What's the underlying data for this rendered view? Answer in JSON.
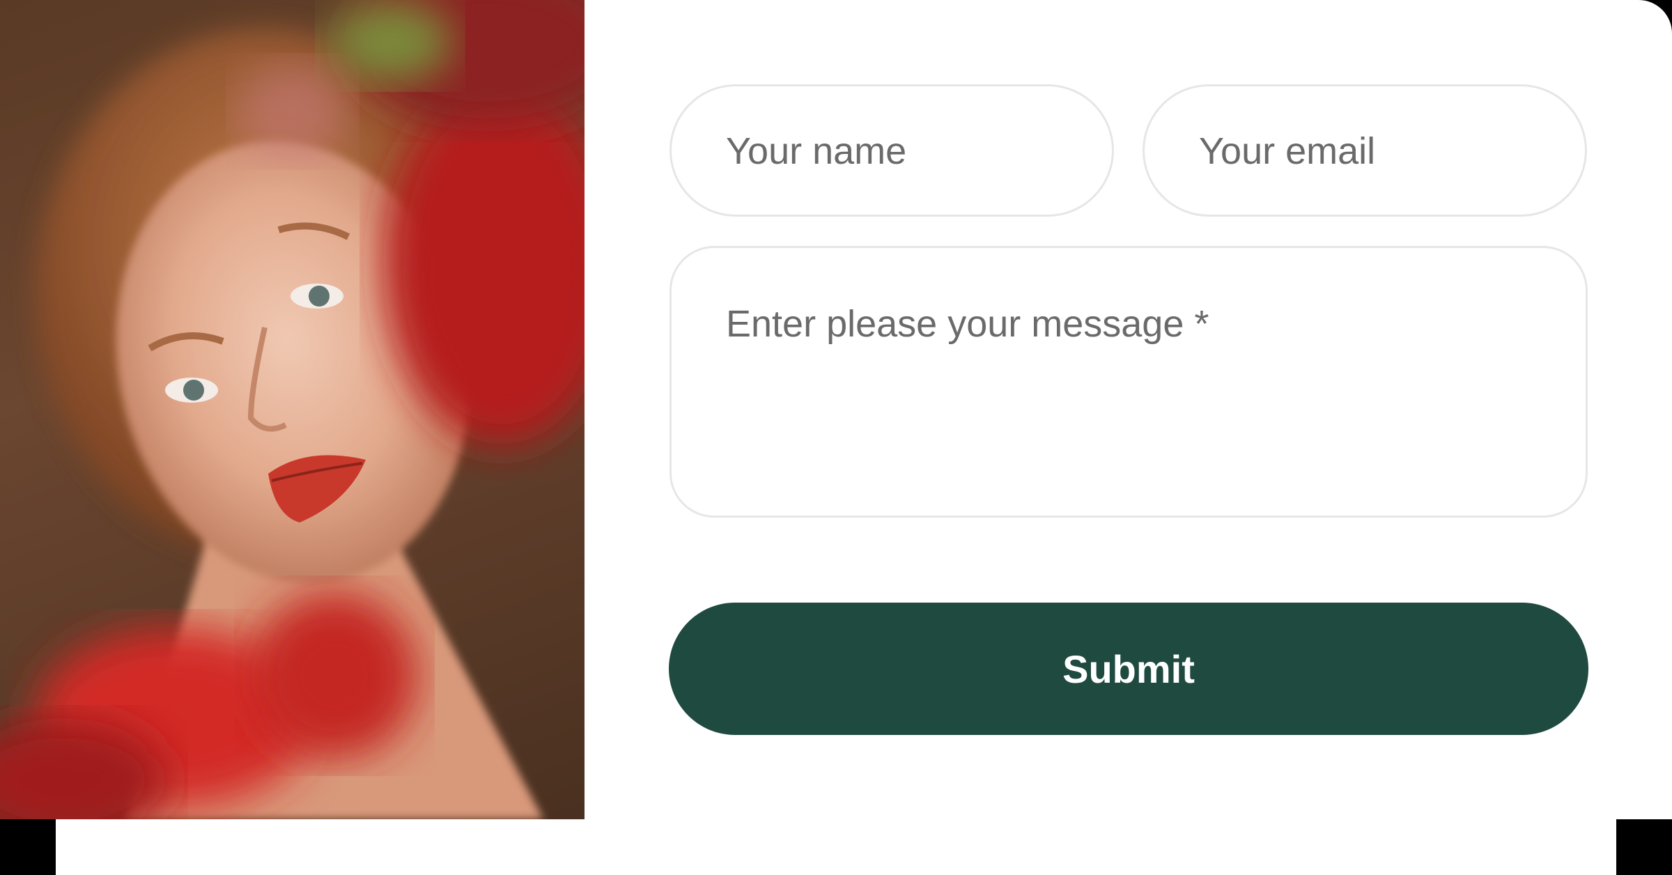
{
  "form": {
    "name_placeholder": "Your name",
    "email_placeholder": "Your email",
    "message_placeholder": "Enter please your message *",
    "submit_label": "Submit"
  },
  "photo": {
    "description_icon": "portrait-photo"
  },
  "colors": {
    "submit_bg": "#1f4a40",
    "field_border": "#e6e6e6",
    "placeholder": "#6a6a6a"
  }
}
